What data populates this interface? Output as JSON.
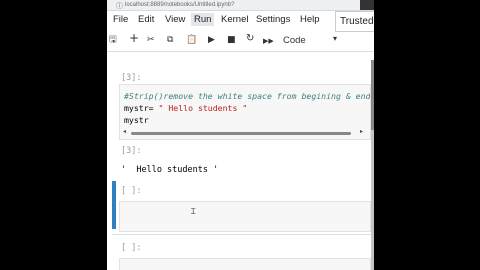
{
  "browser": {
    "url": "localhost:8889/notebooks/Untitled.ipynb?"
  },
  "menu": {
    "items": [
      "File",
      "Edit",
      "View",
      "Run",
      "Kernel",
      "Settings",
      "Help"
    ],
    "active": "Run",
    "trusted": "Trusted"
  },
  "toolbar": {
    "save": "🖫",
    "add": "+",
    "cut": "✂",
    "copy": "⧉",
    "paste": "📋",
    "run": "▶",
    "stop": "■",
    "restart": "↻",
    "restart_run": "▶▶",
    "cell_type": "Code",
    "caret": "▾"
  },
  "cells": {
    "cell1": {
      "prompt": "[3]:",
      "line1": "#Strip()remove the  white space from begining & end",
      "line2_prefix": "mystr= ",
      "line2_string": "\"  Hello students \"",
      "line3": "mystr"
    },
    "out1": {
      "prompt": "[3]:",
      "text": "'  Hello students '"
    },
    "cell2": {
      "prompt": "[ ]:"
    },
    "cell3": {
      "prompt": "[ ]:"
    }
  },
  "colors": {
    "selected_cell": "#2f7fc1",
    "comment": "#3f7f7f",
    "string": "#ba2121"
  }
}
